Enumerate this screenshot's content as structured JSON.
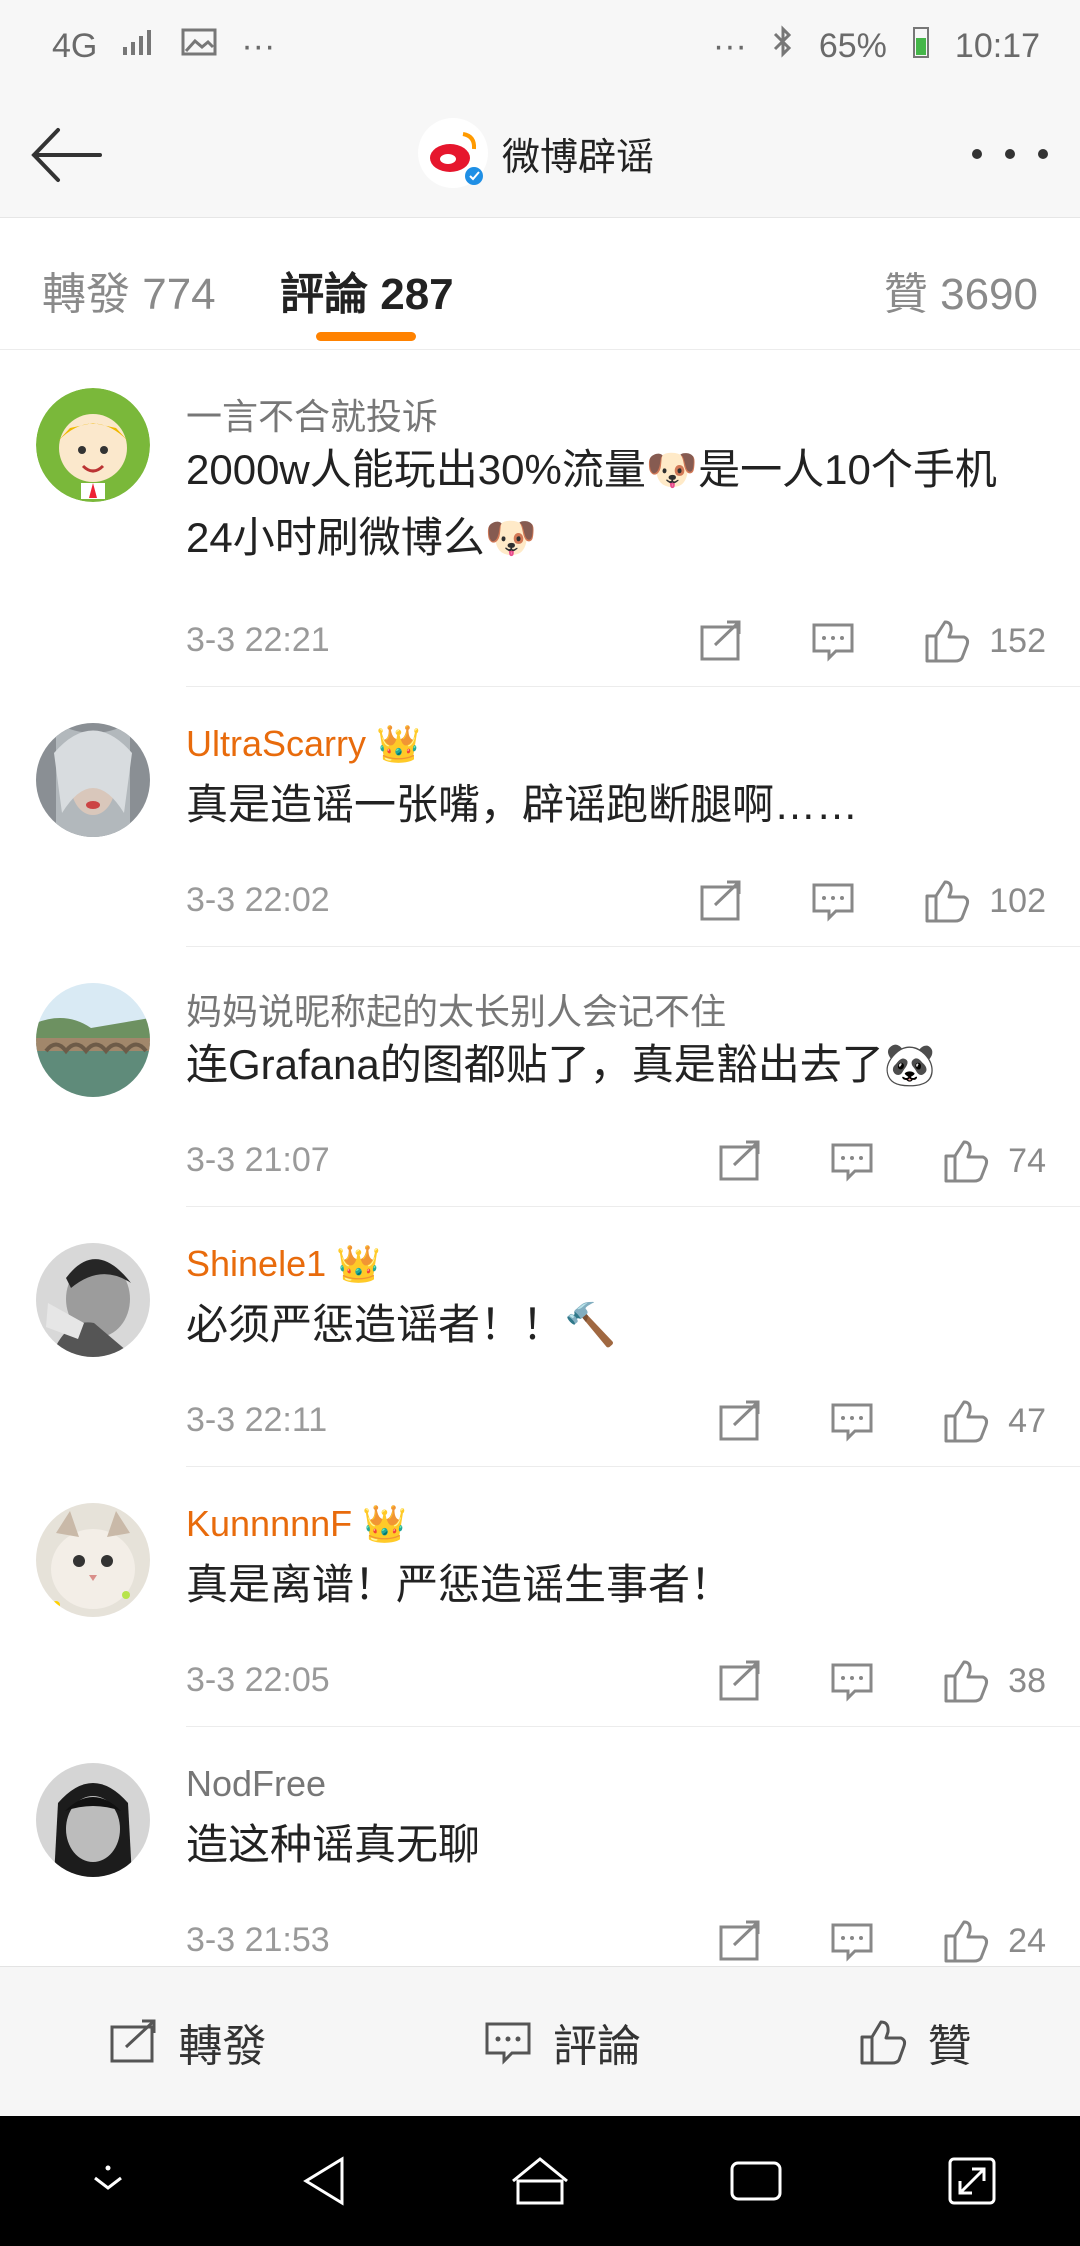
{
  "status": {
    "network": "4G",
    "battery": "65%",
    "time": "10:17"
  },
  "header": {
    "title": "微博辟谣"
  },
  "tabs": [
    {
      "label": "轉發 774"
    },
    {
      "label": "評論 287"
    },
    {
      "label": "贊 3690"
    }
  ],
  "comments": [
    {
      "user": "一言不合就投诉",
      "vip": false,
      "text": "2000w人能玩出30%流量🐶是一人10个手机24小时刷微博么🐶",
      "time": "3-3 22:21",
      "likes": "152"
    },
    {
      "user": "UltraScarry",
      "vip": true,
      "text": "真是造谣一张嘴，辟谣跑断腿啊……",
      "time": "3-3 22:02",
      "likes": "102"
    },
    {
      "user": "妈妈说昵称起的太长别人会记不住",
      "vip": false,
      "text": "连Grafana的图都贴了，真是豁出去了🐼",
      "time": "3-3 21:07",
      "likes": "74"
    },
    {
      "user": "Shinele1",
      "vip": true,
      "text": "必须严惩造谣者！！🔨",
      "time": "3-3 22:11",
      "likes": "47"
    },
    {
      "user": "KunnnnnF",
      "vip": true,
      "text": "真是离谱！严惩造谣生事者！",
      "time": "3-3 22:05",
      "likes": "38"
    },
    {
      "user": "NodFree",
      "vip": false,
      "text": "造这种谣真无聊",
      "time": "3-3 21:53",
      "likes": "24"
    }
  ],
  "bottom": {
    "repost": "轉發",
    "comment": "評論",
    "like": "贊"
  },
  "colors": {
    "accent": "#ff8200",
    "vip_name": "#e86b0c"
  }
}
